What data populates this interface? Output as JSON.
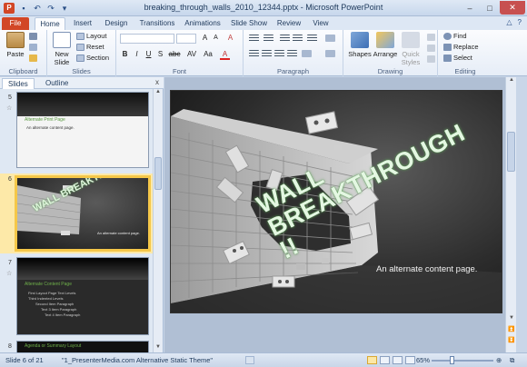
{
  "window": {
    "title": "breaking_through_walls_2010_12344.pptx - Microsoft PowerPoint",
    "app_icon": "P",
    "qat": [
      "save-icon",
      "undo-icon",
      "redo-icon",
      "customize-icon"
    ],
    "controls": {
      "minimize": "–",
      "maximize": "□",
      "close": "✕"
    }
  },
  "ribbon_tabs": [
    "File",
    "Home",
    "Insert",
    "Design",
    "Transitions",
    "Animations",
    "Slide Show",
    "Review",
    "View"
  ],
  "active_tab": "Home",
  "ribbon": {
    "clipboard": {
      "label": "Clipboard",
      "paste": "Paste"
    },
    "slides": {
      "label": "Slides",
      "new_slide": "New",
      "new_slide_2": "Slide",
      "layout": "Layout",
      "reset": "Reset",
      "section": "Section"
    },
    "font": {
      "label": "Font",
      "grow": "A",
      "shrink": "A",
      "clear": "A",
      "bold": "B",
      "italic": "I",
      "underline": "U",
      "strike": "S",
      "shadow": "abc",
      "spacing": "AV",
      "case": "Aa",
      "color": "A"
    },
    "paragraph": {
      "label": "Paragraph"
    },
    "drawing": {
      "label": "Drawing",
      "shapes": "Shapes",
      "arrange": "Arrange",
      "quick_styles": "Quick",
      "quick_styles_2": "Styles"
    },
    "editing": {
      "label": "Editing",
      "find": "Find",
      "replace": "Replace",
      "select": "Select"
    }
  },
  "pane": {
    "tabs": [
      "Slides",
      "Outline"
    ],
    "close": "x",
    "thumbnails": [
      {
        "num": "5",
        "header": "Alternate   Print Page",
        "body": "An alternate content page."
      },
      {
        "num": "6",
        "title": "WALL BREAKTHROUGH !!",
        "body": "An alternate content page."
      },
      {
        "num": "7",
        "header": "Alternate   Content   Page",
        "lines": [
          "First Layout Page Text Levels",
          "Third Indented Levels",
          "Second Item Paragraph",
          "Text 3 Item Paragraph",
          "Text 4 Item Paragraph"
        ]
      },
      {
        "num": "8",
        "header": "Agenda   or Summary   Layout"
      }
    ]
  },
  "slide": {
    "title": "WALL BREAKTHROUGH !!",
    "title_line1": "WALL",
    "title_line2": "BREAKTHROUGH !!",
    "subtitle": "An alternate content page."
  },
  "status": {
    "slide_indicator": "Slide 6 of 21",
    "theme": "\"1_PresenterMedia.com Alternative Static Theme\"",
    "zoom": "65%",
    "zoom_level": 0.65
  },
  "colors": {
    "file_tab": "#d24726",
    "selected_thumb_border": "#f5c749",
    "title_glow": "#5fa35a"
  }
}
